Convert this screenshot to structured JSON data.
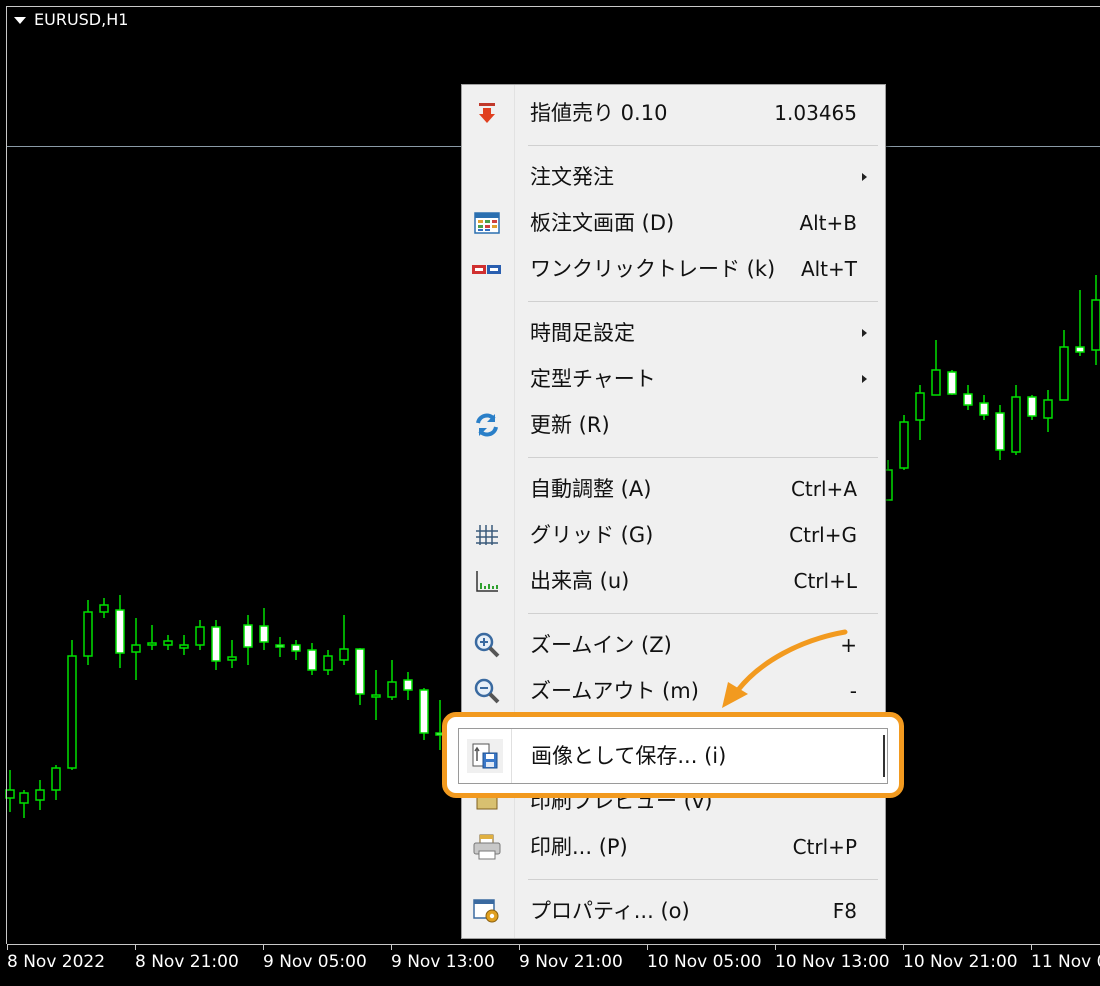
{
  "chart": {
    "symbol": "EURUSD,H1",
    "x_labels": [
      "8 Nov 2022",
      "8 Nov 21:00",
      "9 Nov 05:00",
      "9 Nov 13:00",
      "9 Nov 21:00",
      "10 Nov 05:00",
      "10 Nov 13:00",
      "10 Nov 21:00",
      "11 Nov 0"
    ],
    "bull_color": "#00e000",
    "bear_color": "#00e000",
    "bear_fill": "#ffffff",
    "background": "#000000"
  },
  "menu": {
    "items": [
      {
        "name": "sell-limit",
        "icon": "red-down-arrow-icon",
        "label": "指値売り 0.10",
        "shortcut": "1.03465"
      },
      {
        "name": "order",
        "icon": "",
        "label": "注文発注",
        "submenu": true
      },
      {
        "name": "depth-of-market",
        "icon": "dom-table-icon",
        "label": "板注文画面 (D)",
        "shortcut": "Alt+B"
      },
      {
        "name": "one-click-trading",
        "icon": "one-click-icon",
        "label": "ワンクリックトレード (k)",
        "shortcut": "Alt+T"
      },
      {
        "name": "timeframes",
        "icon": "",
        "label": "時間足設定",
        "submenu": true
      },
      {
        "name": "templates",
        "icon": "",
        "label": "定型チャート",
        "submenu": true
      },
      {
        "name": "refresh",
        "icon": "refresh-icon",
        "label": "更新 (R)"
      },
      {
        "name": "auto-scroll",
        "icon": "",
        "label": "自動調整 (A)",
        "shortcut": "Ctrl+A"
      },
      {
        "name": "grid",
        "icon": "grid-icon",
        "label": "グリッド (G)",
        "shortcut": "Ctrl+G"
      },
      {
        "name": "volumes",
        "icon": "volumes-icon",
        "label": "出来高 (u)",
        "shortcut": "Ctrl+L"
      },
      {
        "name": "zoom-in",
        "icon": "zoom-in-icon",
        "label": "ズームイン (Z)",
        "shortcut": "+"
      },
      {
        "name": "zoom-out",
        "icon": "zoom-out-icon",
        "label": "ズームアウト (m)",
        "shortcut": "-"
      },
      {
        "name": "save-as-picture",
        "icon": "save-picture-icon",
        "label": "画像として保存... (i)"
      },
      {
        "name": "print-preview",
        "icon": "print-preview-icon",
        "label": "印刷プレビュー (v)"
      },
      {
        "name": "print",
        "icon": "printer-icon",
        "label": "印刷... (P)",
        "shortcut": "Ctrl+P"
      },
      {
        "name": "properties",
        "icon": "properties-icon",
        "label": "プロパティ... (o)",
        "shortcut": "F8"
      }
    ]
  },
  "highlight_color": "#f29a1f"
}
